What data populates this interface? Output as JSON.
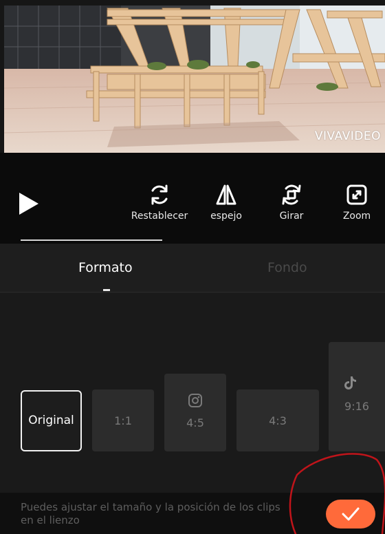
{
  "preview": {
    "watermark": "VIVAVIDEO"
  },
  "toolbar": {
    "tools": [
      {
        "label": "Restablecer",
        "icon": "reset-icon"
      },
      {
        "label": "espejo",
        "icon": "mirror-icon"
      },
      {
        "label": "Girar",
        "icon": "rotate-icon"
      },
      {
        "label": "Zoom",
        "icon": "zoom-icon"
      }
    ],
    "play_icon": "play-icon"
  },
  "tabs": {
    "active": "Formato",
    "items": [
      {
        "label": "Formato",
        "active": true
      },
      {
        "label": "Fondo",
        "active": false
      }
    ]
  },
  "ratios": {
    "selected": "Original",
    "items": [
      {
        "label": "Original",
        "selected": true
      },
      {
        "label": "1:1",
        "selected": false
      },
      {
        "label": "4:5",
        "selected": false,
        "icon": "instagram-icon"
      },
      {
        "label": "4:3",
        "selected": false
      },
      {
        "label": "9:16",
        "selected": false,
        "icon": "tiktok-icon"
      }
    ]
  },
  "hint": {
    "text": "Puedes ajustar el tamaño y la posición de los clips en el lienzo"
  },
  "colors": {
    "accent": "#ff6a3a",
    "annotation": "#c0141a",
    "background": "#161616"
  }
}
